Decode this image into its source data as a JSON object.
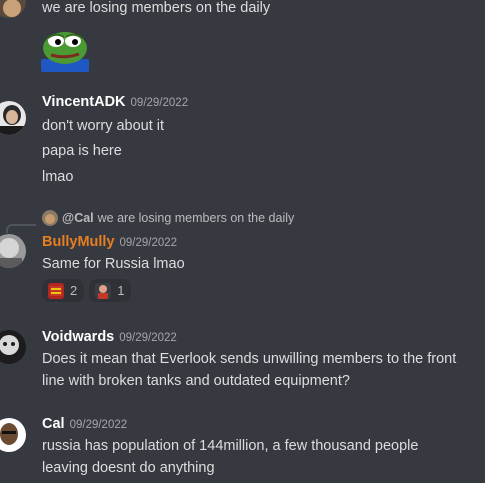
{
  "messages": {
    "top": {
      "text": "we are losing members on the daily",
      "emote": "pepe-emote"
    },
    "vincent": {
      "author": "VincentADK",
      "timestamp": "09/29/2022",
      "lines": [
        "don't worry about it",
        "papa is here",
        "lmao"
      ]
    },
    "bully": {
      "reply": {
        "author": "@Cal",
        "text": "we are losing members on the daily"
      },
      "author": "BullyMully",
      "author_color": "#e67e22",
      "timestamp": "09/29/2022",
      "text": "Same for Russia lmao",
      "reactions": [
        {
          "emoji": "soviet-flag-emoji",
          "count": "2"
        },
        {
          "emoji": "person-emoji",
          "count": "1"
        }
      ]
    },
    "voidwards": {
      "author": "Voidwards",
      "timestamp": "09/29/2022",
      "lines": [
        "Does it mean that Everlook sends unwilling members to the front",
        "line with broken tanks and outdated equipment?"
      ]
    },
    "cal": {
      "author": "Cal",
      "timestamp": "09/29/2022",
      "lines": [
        "russia has population of 144million, a few thousand people",
        "leaving doesnt do anything"
      ]
    }
  }
}
